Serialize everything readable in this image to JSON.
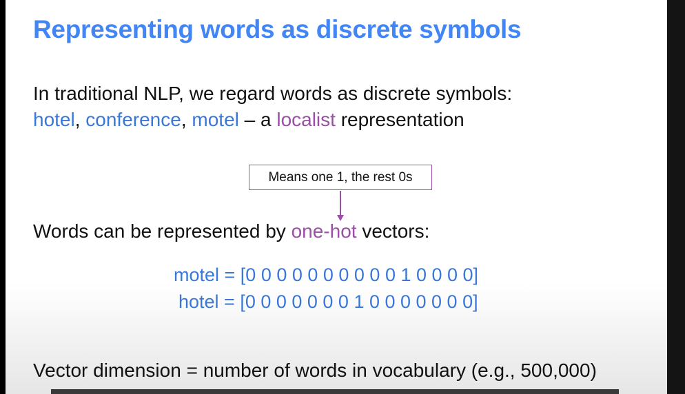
{
  "slide": {
    "title": "Representing words as discrete symbols",
    "intro": {
      "line1": "In traditional NLP, we regard words as discrete symbols:",
      "word1": "hotel",
      "sep1": ", ",
      "word2": "conference",
      "sep2": ", ",
      "word3": "motel",
      "dash": " – a ",
      "localist": "localist",
      "representation": " representation"
    },
    "callout": "Means one 1, the rest 0s",
    "onehot": {
      "prefix": "Words can be represented by ",
      "term": "one-hot",
      "suffix": " vectors:"
    },
    "vectors": {
      "motel": "motel = [0 0 0 0 0 0 0 0 0 0 1 0 0 0 0]",
      "hotel": "hotel = [0 0 0 0 0 0 0 1 0 0 0 0 0 0 0]"
    },
    "dimension": "Vector dimension = number of words in vocabulary (e.g., 500,000)"
  },
  "colors": {
    "title": "#4285f4",
    "word_blue": "#3a78d8",
    "accent_purple": "#9b4fa6",
    "text": "#111111"
  }
}
